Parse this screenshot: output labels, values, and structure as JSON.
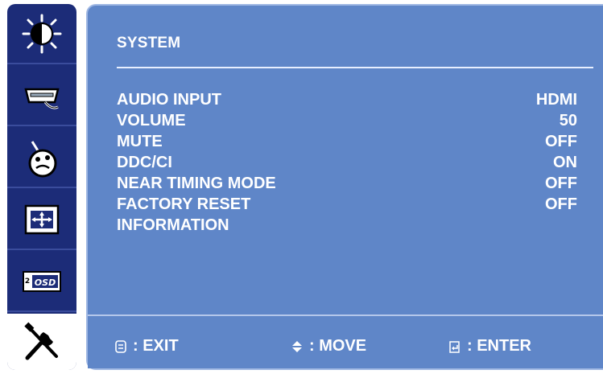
{
  "sidebar": {
    "items": [
      {
        "name": "brightness-contrast",
        "icon": "brightness-icon",
        "active": false
      },
      {
        "name": "input-source",
        "icon": "input-connector-icon",
        "active": false
      },
      {
        "name": "color",
        "icon": "color-palette-icon",
        "active": false
      },
      {
        "name": "position",
        "icon": "move-arrows-icon",
        "active": false
      },
      {
        "name": "osd",
        "icon": "osd-icon",
        "active": false
      },
      {
        "name": "system",
        "icon": "tools-icon",
        "active": true
      }
    ]
  },
  "panel": {
    "title": "SYSTEM",
    "rows": [
      {
        "label": "AUDIO INPUT",
        "value": "HDMI"
      },
      {
        "label": "VOLUME",
        "value": "50"
      },
      {
        "label": "MUTE",
        "value": "OFF"
      },
      {
        "label": "DDC/CI",
        "value": "ON"
      },
      {
        "label": "NEAR TIMING MODE",
        "value": "OFF"
      },
      {
        "label": "FACTORY RESET",
        "value": "OFF"
      },
      {
        "label": "INFORMATION",
        "value": ""
      }
    ]
  },
  "footer": {
    "exit_label": ": EXIT",
    "move_label": ": MOVE",
    "enter_label": ": ENTER"
  },
  "colors": {
    "sidebar_bg": "#1c2c78",
    "panel_bg": "#5f86c8",
    "text": "#ffffff"
  }
}
